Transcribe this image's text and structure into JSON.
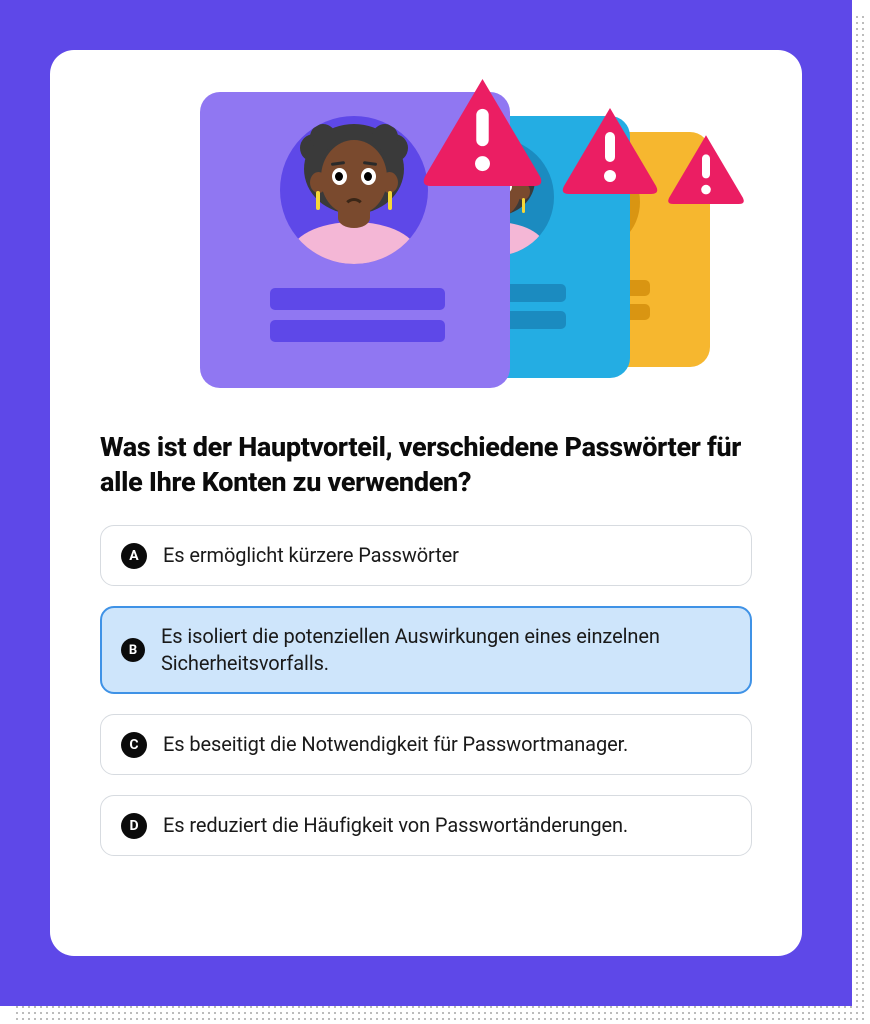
{
  "question": "Was ist der Hauptvorteil, verschiedene Passwörter für alle Ihre Konten zu verwenden?",
  "options": [
    {
      "letter": "A",
      "text": "Es ermöglicht kürzere Passwörter",
      "selected": false
    },
    {
      "letter": "B",
      "text": "Es isoliert die potenziellen Auswirkungen eines einzelnen Sicherheitsvorfalls.",
      "selected": true
    },
    {
      "letter": "C",
      "text": "Es beseitigt die Notwendigkeit für Passwortmanager.",
      "selected": false
    },
    {
      "letter": "D",
      "text": "Es reduziert die Häufigkeit von Passwortänderungen.",
      "selected": false
    }
  ],
  "colors": {
    "frame": "#5E48E8",
    "cardViolet": "#9077F2",
    "cardCyan": "#24ADE3",
    "cardYellow": "#F6B72F",
    "warn": "#EB1E63",
    "selectedBorder": "#3F92E6",
    "selectedBg": "#CEE5FB"
  },
  "illustration": {
    "cards": [
      "violet",
      "cyan",
      "yellow"
    ],
    "warning_icon": "exclamation-triangle"
  }
}
